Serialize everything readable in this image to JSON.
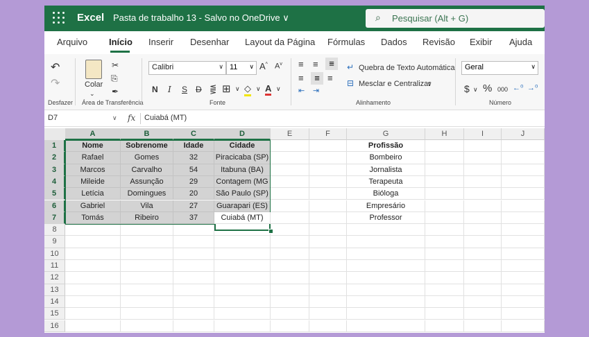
{
  "titlebar": {
    "app_name": "Excel",
    "doc_name": "Pasta de trabalho 13  -  Salvo no OneDrive ∨",
    "search_placeholder": "Pesquisar (Alt + G)"
  },
  "menu": {
    "tabs": [
      "Arquivo",
      "Início",
      "Inserir",
      "Desenhar",
      "Layout da Página",
      "Fórmulas",
      "Dados",
      "Revisão",
      "Exibir",
      "Ajuda"
    ],
    "active": "Início"
  },
  "ribbon": {
    "groups": {
      "undo": "Desfazer",
      "clipboard": "Área de Transferência",
      "font": "Fonte",
      "alignment": "Alinhamento",
      "number": "Número"
    },
    "paste_label": "Colar",
    "font_name": "Calibri",
    "font_size": "11",
    "wrap_text": "Quebra de Texto Automática",
    "merge_center": "Mesclar e Centralizar",
    "number_format": "Geral",
    "decimals_label": "000"
  },
  "formula_bar": {
    "name_box": "D7",
    "fx": "fx",
    "value": "Cuiabá (MT)"
  },
  "sheet": {
    "columns": [
      "A",
      "B",
      "C",
      "D",
      "E",
      "F",
      "G",
      "H",
      "I",
      "J"
    ],
    "rows": [
      "1",
      "2",
      "3",
      "4",
      "5",
      "6",
      "7",
      "8",
      "9",
      "10",
      "11",
      "12",
      "13",
      "14",
      "15",
      "16"
    ],
    "headers": [
      "Nome",
      "Sobrenome",
      "Idade",
      "Cidade"
    ],
    "data": [
      [
        "Rafael",
        "Gomes",
        "32",
        "Piracicaba (SP)"
      ],
      [
        "Marcos",
        "Carvalho",
        "54",
        "Itabuna (BA)"
      ],
      [
        "Mileide",
        "Assunção",
        "29",
        "Contagem (MG"
      ],
      [
        "Letícia",
        "Domingues",
        "20",
        "São Paulo (SP)"
      ],
      [
        "Gabriel",
        "Vila",
        "27",
        "Guarapari (ES)"
      ],
      [
        "Tomás",
        "Ribeiro",
        "37",
        "Cuiabá (MT)"
      ]
    ],
    "g_header": "Profissão",
    "g_values": [
      "Bombeiro",
      "Jornalista",
      "Terapeuta",
      "Bióloga",
      "Empresário",
      "Professor"
    ]
  },
  "colors": {
    "brand_green": "#1e7145",
    "background_lavender": "#b49ad6",
    "selection_gray": "#d3d3d3"
  }
}
